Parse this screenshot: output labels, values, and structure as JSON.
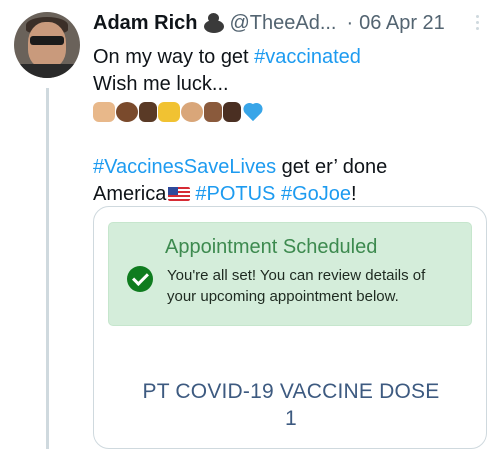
{
  "tweet": {
    "author_name": "Adam Rich",
    "author_handle": "@TheeAd...",
    "separator": "·",
    "date": "06 Apr 21",
    "line1_prefix": "On my way to get ",
    "line1_hashtag": "#vaccinated",
    "line2": "Wish me luck...",
    "emojis": [
      "raising-hands",
      "oncoming-fist",
      "thumbs-up",
      "love-you-gesture",
      "oncoming-fist",
      "victory-hand",
      "folded-hands",
      "blue-heart"
    ],
    "line3_hashtag": "#VaccinesSaveLives",
    "line3_text": " get er’ done",
    "line4_text": "America",
    "line4_hashtag1": "#POTUS",
    "line4_hashtag2": "#GoJoe",
    "line4_suffix": "!"
  },
  "card": {
    "banner_title": "Appointment Scheduled",
    "banner_line1": "You're all set! You can review details of",
    "banner_line2": "your upcoming appointment below.",
    "dose_title_line1": "PT COVID-19 VACCINE DOSE",
    "dose_title_line2": "1"
  },
  "colors": {
    "link": "#1d9bf0",
    "banner_bg": "#d4edda",
    "banner_title": "#3d8a4f",
    "check": "#0f7c1f",
    "dose_title": "#3d5a80"
  },
  "icons": {
    "author_badge": "gorilla-icon",
    "more": "more-vertical-icon",
    "check": "check-circle-icon",
    "flag": "us-flag-icon"
  }
}
